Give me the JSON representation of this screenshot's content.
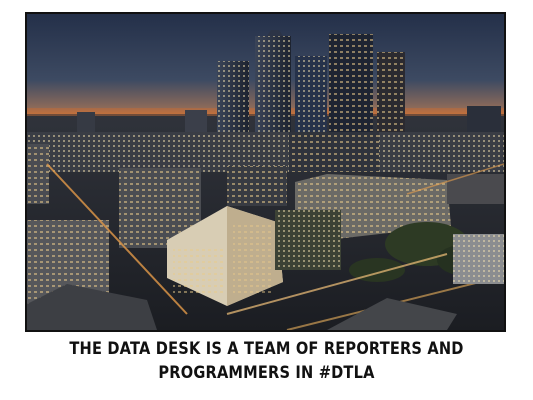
{
  "photo": {
    "subject": "night-city-skyline-photo"
  },
  "caption": {
    "line1": "THE DATA DESK IS A TEAM OF REPORTERS AND",
    "line2": "PROGRAMMERS IN #DTLA"
  },
  "colors": {
    "background": "#ffffff",
    "caption_text": "#111111",
    "sky_top": "#1f2e48",
    "sky_horizon": "#c8743a"
  }
}
